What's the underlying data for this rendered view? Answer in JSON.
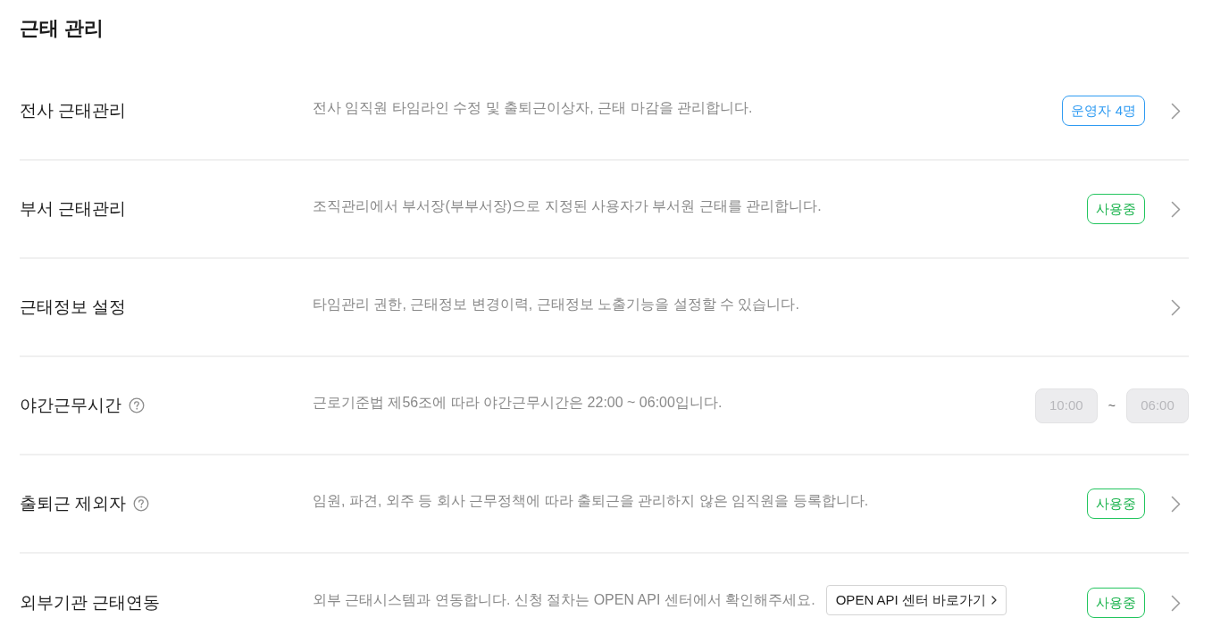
{
  "title": "근태 관리",
  "rows": [
    {
      "label": "전사 근태관리",
      "help": false,
      "description": "전사 임직원 타임라인 수정 및 출퇴근이상자, 근태 마감을 관리합니다.",
      "badge": {
        "kind": "count",
        "text": "운영자 4명"
      },
      "chevron": true
    },
    {
      "label": "부서 근태관리",
      "help": false,
      "description": "조직관리에서 부서장(부부서장)으로 지정된 사용자가 부서원 근태를 관리합니다.",
      "badge": {
        "kind": "status",
        "text": "사용중"
      },
      "chevron": true
    },
    {
      "label": "근태정보 설정",
      "help": false,
      "description": "타임관리 권한, 근태정보 변경이력, 근태정보 노출기능을 설정할 수 있습니다.",
      "chevron": true
    },
    {
      "label": "야간근무시간",
      "help": true,
      "description": "근로기준법 제56조에 따라 야간근무시간은 22:00 ~ 06:00입니다.",
      "time_range": {
        "start": {
          "value": "10:00",
          "disabled": true
        },
        "separator": "~",
        "end": {
          "value": "06:00",
          "disabled": true
        }
      },
      "chevron": false
    },
    {
      "label": "출퇴근 제외자",
      "help": true,
      "description": "임원, 파견, 외주 등 회사 근무정책에 따라 출퇴근을 관리하지 않은 임직원을 등록합니다.",
      "badge": {
        "kind": "status",
        "text": "사용중"
      },
      "chevron": true
    },
    {
      "label": "외부기관 근태연동",
      "help": false,
      "description": "외부 근태시스템과 연동합니다. 신청 절차는 OPEN API 센터에서 확인해주세요.",
      "link_button": {
        "label": "OPEN API 센터 바로가기"
      },
      "badge": {
        "kind": "status",
        "text": "사용중"
      },
      "chevron": true
    }
  ]
}
